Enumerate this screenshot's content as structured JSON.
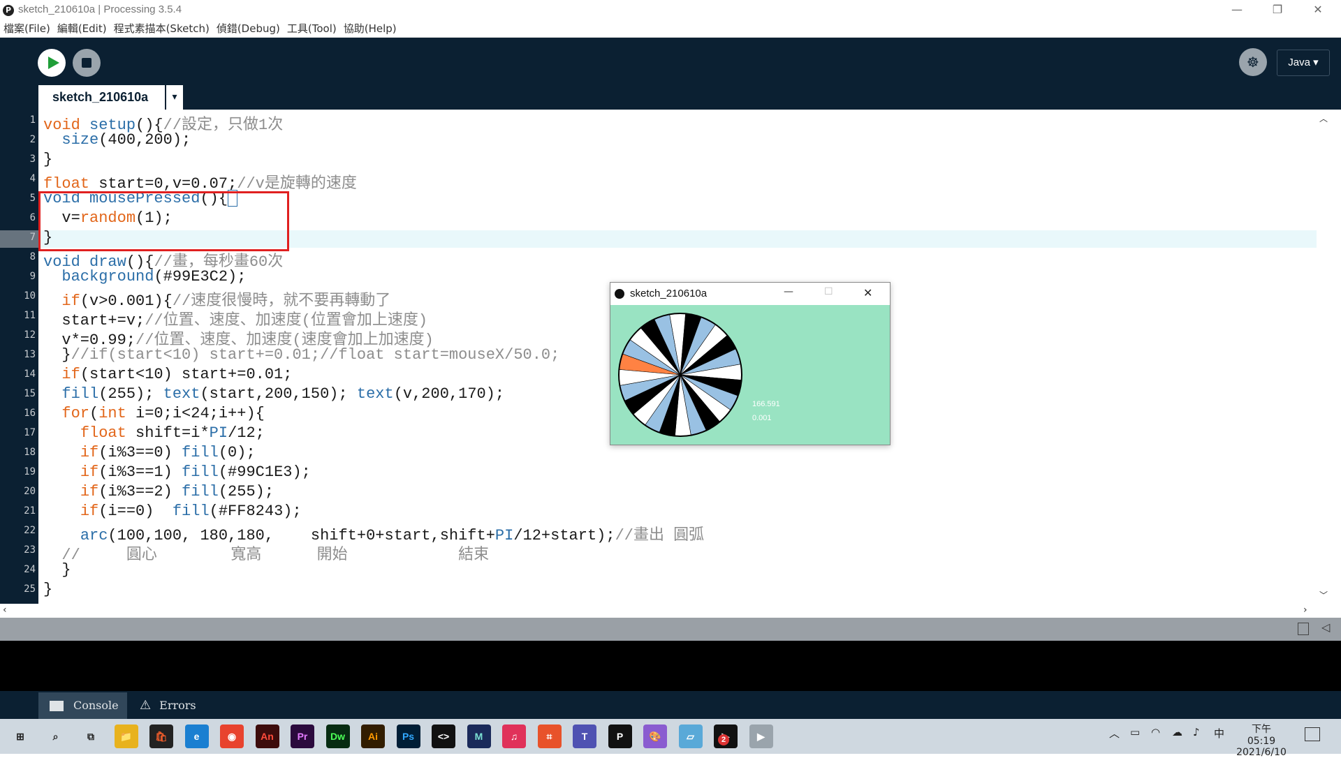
{
  "window": {
    "title": "sketch_210610a | Processing 3.5.4",
    "minimize": "—",
    "maximize": "❐",
    "close": "✕"
  },
  "menu": [
    "檔案(File)",
    "編輯(Edit)",
    "程式素描本(Sketch)",
    "偵錯(Debug)",
    "工具(Tool)",
    "協助(Help)"
  ],
  "toolbar": {
    "debug_glyph": "☸",
    "mode": "Java ▾"
  },
  "tabs": {
    "active": "sketch_210610a",
    "menu_glyph": "▾"
  },
  "line_numbers": [
    "1",
    "2",
    "3",
    "4",
    "5",
    "6",
    "7",
    "8",
    "9",
    "10",
    "11",
    "12",
    "13",
    "14",
    "15",
    "16",
    "17",
    "18",
    "19",
    "20",
    "21",
    "22",
    "23",
    "24",
    "25"
  ],
  "code": {
    "l1a": "void",
    "l1b": " setup",
    "l1c": "(){",
    "l1d": "//設定，只做1次",
    "l2a": "  ",
    "l2b": "size",
    "l2c": "(400,200);",
    "l3": "}",
    "l4a": "float",
    "l4b": " start=0,v=0.07;",
    "l4c": "//v是旋轉的速度",
    "l5a": "void",
    "l5b": " mousePressed",
    "l5c": "(){",
    "l6a": "  v=",
    "l6b": "random",
    "l6c": "(1);",
    "l7": "}",
    "l8a": "void",
    "l8b": " draw",
    "l8c": "(){",
    "l8d": "//畫，每秒畫60次",
    "l9a": "  ",
    "l9b": "background",
    "l9c": "(#99E3C2);",
    "l10a": "  ",
    "l10b": "if",
    "l10c": "(v>0.001){",
    "l10d": "//速度很慢時，就不要再轉動了",
    "l11a": "  start+=v;",
    "l11b": "//位置、速度、加速度(位置會加上速度)",
    "l12a": "  v*=0.99;",
    "l12b": "//位置、速度、加速度(速度會加上加速度)",
    "l13a": "  }",
    "l13b": "//if(start<10) start+=0.01;//float start=mouseX/50.0;",
    "l14a": "  ",
    "l14b": "if",
    "l14c": "(start<10) start+=0.01;",
    "l15a": "  ",
    "l15b": "fill",
    "l15c": "(255); ",
    "l15d": "text",
    "l15e": "(start,200,150); ",
    "l15f": "text",
    "l15g": "(v,200,170);",
    "l16a": "  ",
    "l16b": "for",
    "l16c": "(",
    "l16d": "int",
    "l16e": " i=0;i<24;i++){",
    "l17a": "    ",
    "l17b": "float",
    "l17c": " shift=i*",
    "l17d": "PI",
    "l17e": "/12;",
    "l18a": "    ",
    "l18b": "if",
    "l18c": "(i%3==0) ",
    "l18d": "fill",
    "l18e": "(0);",
    "l19a": "    ",
    "l19b": "if",
    "l19c": "(i%3==1) ",
    "l19d": "fill",
    "l19e": "(#99C1E3);",
    "l20a": "    ",
    "l20b": "if",
    "l20c": "(i%3==2) ",
    "l20d": "fill",
    "l20e": "(255);",
    "l21a": "    ",
    "l21b": "if",
    "l21c": "(i==0)  ",
    "l21d": "fill",
    "l21e": "(#FF8243);",
    "l22a": "    ",
    "l22b": "arc",
    "l22c": "(100,100, 180,180,    shift+0+start,shift+",
    "l22d": "PI",
    "l22e": "/12+start);",
    "l22f": "//畫出 圓弧",
    "l23": "  //     圓心        寬高      開始            結束",
    "l24": "  }",
    "l25": "}"
  },
  "sketch_window": {
    "title": "sketch_210610a",
    "minimize": "—",
    "maximize": "☐",
    "close": "✕",
    "background": "#99E3C2",
    "text_start": "166.591",
    "text_v": "0.001",
    "wheel_colors": [
      "#000000",
      "#99C1E3",
      "#FFFFFF"
    ],
    "first_segment_color": "#FF8243"
  },
  "footer": {
    "console": "Console",
    "errors": "Errors"
  },
  "taskbar": {
    "apps": [
      "⊞",
      "⌕",
      "⧉",
      "📁",
      "🛍",
      "e",
      "◉",
      "An",
      "Pr",
      "Dw",
      "Ai",
      "Ps",
      "<>",
      "M",
      "♫",
      "⌗",
      "T",
      "P",
      "🎨",
      "▱",
      "▶",
      "▶"
    ],
    "badge": "2",
    "tray_chevron": "︿",
    "tray_lang": "中",
    "time": "下午 05:19",
    "date": "2021/6/10"
  }
}
